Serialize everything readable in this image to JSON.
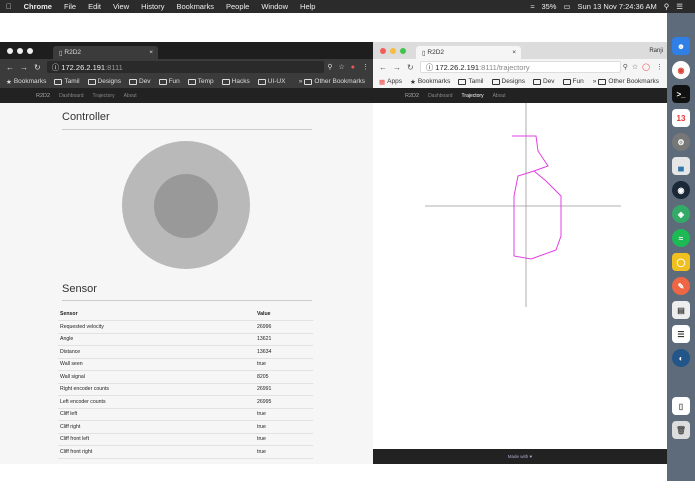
{
  "menubar": {
    "apple": "",
    "app": "Chrome",
    "items": [
      "File",
      "Edit",
      "View",
      "History",
      "Bookmarks",
      "People",
      "Window",
      "Help"
    ],
    "battery": "35%",
    "datetime": "Sun 13 Nov  7:24:36 AM"
  },
  "left": {
    "tab_title": "R2D2",
    "url_host": "172.26.2.191",
    "url_port": ":8111",
    "bookmarks": [
      "Bookmarks",
      "Tamil",
      "Designs",
      "Dev",
      "Fun",
      "Temp",
      "Hacks",
      "UI-UX"
    ],
    "other_bookmarks": "Other Bookmarks",
    "nav": [
      "R2D2",
      "Dashboard",
      "Trajectory",
      "About"
    ],
    "controller_title": "Controller",
    "sensor_title": "Sensor",
    "table_headers": [
      "Sensor",
      "Value"
    ],
    "rows": [
      [
        "Requested velocity",
        "26996"
      ],
      [
        "Angle",
        "13621"
      ],
      [
        "Distance",
        "13634"
      ],
      [
        "Wall seen",
        "true"
      ],
      [
        "Wall signal",
        "8205"
      ],
      [
        "Right encoder counts",
        "26991"
      ],
      [
        "Left encoder counts",
        "26995"
      ],
      [
        "Cliff left",
        "true"
      ],
      [
        "Cliff right",
        "true"
      ],
      [
        "Cliff front left",
        "true"
      ],
      [
        "Cliff front right",
        "true"
      ]
    ]
  },
  "right": {
    "tab_title": "R2D2",
    "profile": "Ranji",
    "url_host": "172.26.2.191",
    "url_path": ":8111/trajectory",
    "apps": "Apps",
    "bookmarks": [
      "Bookmarks",
      "Tamil",
      "Designs",
      "Dev",
      "Fun"
    ],
    "other_bookmarks": "Other Bookmarks",
    "nav": [
      "R2D2",
      "Dashboard",
      "Trajectory",
      "About"
    ],
    "footer": "Made with ♥",
    "trajectory_color": "#e040e0"
  },
  "chart_data": {
    "type": "line",
    "title": "",
    "xlabel": "",
    "ylabel": "",
    "series": [
      {
        "values": [
          [
            -14,
            70
          ],
          [
            10,
            70
          ],
          [
            12,
            55
          ],
          [
            22,
            40
          ],
          [
            8,
            35
          ],
          [
            -8,
            30
          ],
          [
            -12,
            10
          ],
          [
            -12,
            -50
          ],
          [
            5,
            -53
          ],
          [
            30,
            -44
          ],
          [
            35,
            -30
          ],
          [
            35,
            10
          ],
          [
            20,
            25
          ],
          [
            8,
            35
          ]
        ]
      }
    ]
  }
}
